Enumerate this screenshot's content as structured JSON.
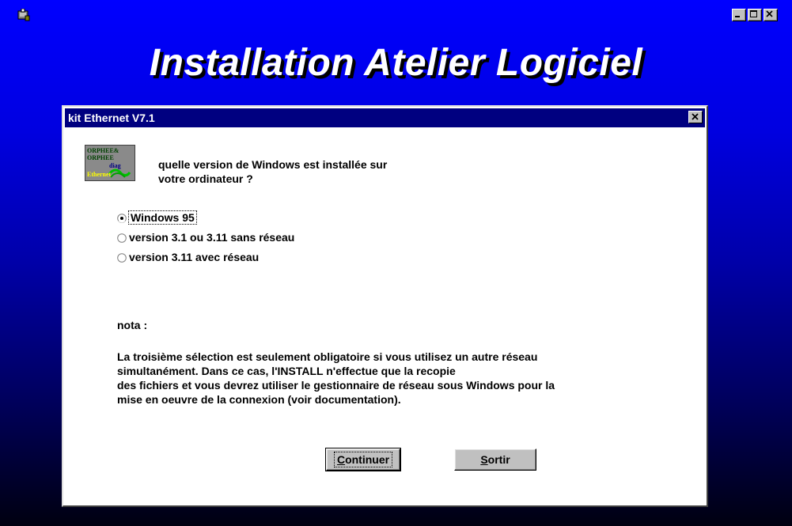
{
  "window": {
    "title": "Installation Atelier Logiciel",
    "controls": {
      "minimize": "minimize-icon",
      "maximize": "maximize-icon",
      "close": "close-icon"
    }
  },
  "dialog": {
    "title": "kit Ethernet V7.1",
    "logo_text": [
      "ORPHEE&",
      "ORPHEE",
      "diag",
      "Ethernet"
    ],
    "question_lines": [
      "quelle version de Windows est installée sur",
      "votre ordinateur ?"
    ],
    "options": [
      {
        "label": "Windows 95",
        "selected": true
      },
      {
        "label": "version 3.1 ou 3.11 sans réseau",
        "selected": false
      },
      {
        "label": "version 3.11 avec réseau",
        "selected": false
      }
    ],
    "nota_label": "nota :",
    "note_lines": [
      "La troisième sélection est seulement obligatoire si vous utilisez un autre réseau",
      "simultanément. Dans ce cas, l'INSTALL n'effectue que la recopie",
      "des fichiers et vous devrez utiliser le gestionnaire de réseau sous Windows pour la",
      "mise en oeuvre de la connexion (voir documentation)."
    ],
    "buttons": {
      "continue": "Continuer",
      "exit": "Sortir"
    }
  },
  "colors": {
    "desktop_gradient_top": "#0000ff",
    "desktop_gradient_bottom": "#000010",
    "titlebar": "#000080",
    "button_face": "#c0c0c0"
  }
}
